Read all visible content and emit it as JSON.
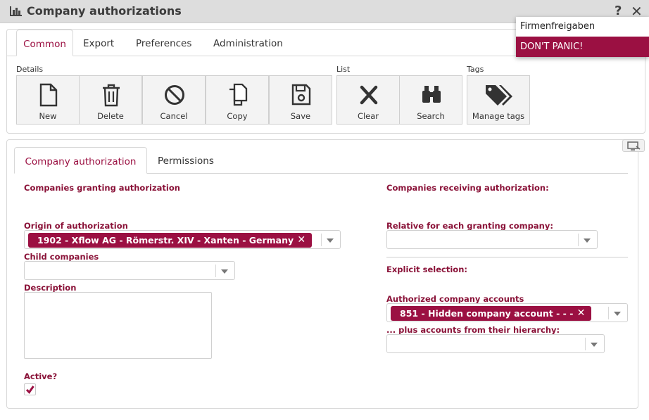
{
  "window": {
    "title": "Company authorizations",
    "help_glyph": "?",
    "close_glyph": "✕"
  },
  "popup": {
    "items": [
      "Firmenfreigaben",
      "DON'T PANIC!"
    ],
    "highlight_color": "#9b1042"
  },
  "top_tabs": [
    "Common",
    "Export",
    "Preferences",
    "Administration"
  ],
  "toolbar": {
    "groups": [
      "Details",
      "List",
      "Tags"
    ],
    "buttons": [
      {
        "label": "New",
        "icon": "new-file-icon"
      },
      {
        "label": "Delete",
        "icon": "trash-icon"
      },
      {
        "label": "Cancel",
        "icon": "cancel-icon"
      },
      {
        "label": "Copy",
        "icon": "copy-icon"
      },
      {
        "label": "Save",
        "icon": "save-icon"
      },
      {
        "label": "Clear",
        "icon": "clear-x-icon"
      },
      {
        "label": "Search",
        "icon": "binoculars-icon"
      },
      {
        "label": "Manage tags",
        "icon": "tags-icon"
      }
    ]
  },
  "form_tabs": [
    "Company authorization",
    "Permissions"
  ],
  "form": {
    "left": {
      "section_heading": "Companies granting authorization",
      "origin_label": "Origin of authorization",
      "origin_value": "1902 - Xflow AG - Römerstr. XIV - Xanten - Germany",
      "child_label": "Child companies",
      "description_label": "Description",
      "active_label": "Active?",
      "active_checked": true
    },
    "right": {
      "section_heading": "Companies receiving authorization:",
      "relative_label": "Relative for each granting company:",
      "explicit_label": "Explicit selection:",
      "accounts_label": "Authorized company accounts",
      "accounts_value": "851 - Hidden company account - - -",
      "hierarchy_label": "... plus accounts from their hierarchy:"
    }
  },
  "colors": {
    "accent": "#9b1042",
    "label": "#8a1238"
  }
}
